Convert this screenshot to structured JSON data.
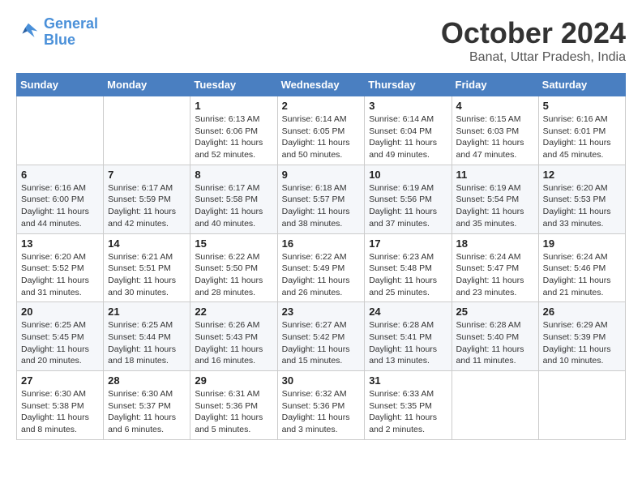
{
  "header": {
    "logo_line1": "General",
    "logo_line2": "Blue",
    "month_title": "October 2024",
    "subtitle": "Banat, Uttar Pradesh, India"
  },
  "weekdays": [
    "Sunday",
    "Monday",
    "Tuesday",
    "Wednesday",
    "Thursday",
    "Friday",
    "Saturday"
  ],
  "weeks": [
    [
      {
        "day": "",
        "sunrise": "",
        "sunset": "",
        "daylight": ""
      },
      {
        "day": "",
        "sunrise": "",
        "sunset": "",
        "daylight": ""
      },
      {
        "day": "1",
        "sunrise": "Sunrise: 6:13 AM",
        "sunset": "Sunset: 6:06 PM",
        "daylight": "Daylight: 11 hours and 52 minutes."
      },
      {
        "day": "2",
        "sunrise": "Sunrise: 6:14 AM",
        "sunset": "Sunset: 6:05 PM",
        "daylight": "Daylight: 11 hours and 50 minutes."
      },
      {
        "day": "3",
        "sunrise": "Sunrise: 6:14 AM",
        "sunset": "Sunset: 6:04 PM",
        "daylight": "Daylight: 11 hours and 49 minutes."
      },
      {
        "day": "4",
        "sunrise": "Sunrise: 6:15 AM",
        "sunset": "Sunset: 6:03 PM",
        "daylight": "Daylight: 11 hours and 47 minutes."
      },
      {
        "day": "5",
        "sunrise": "Sunrise: 6:16 AM",
        "sunset": "Sunset: 6:01 PM",
        "daylight": "Daylight: 11 hours and 45 minutes."
      }
    ],
    [
      {
        "day": "6",
        "sunrise": "Sunrise: 6:16 AM",
        "sunset": "Sunset: 6:00 PM",
        "daylight": "Daylight: 11 hours and 44 minutes."
      },
      {
        "day": "7",
        "sunrise": "Sunrise: 6:17 AM",
        "sunset": "Sunset: 5:59 PM",
        "daylight": "Daylight: 11 hours and 42 minutes."
      },
      {
        "day": "8",
        "sunrise": "Sunrise: 6:17 AM",
        "sunset": "Sunset: 5:58 PM",
        "daylight": "Daylight: 11 hours and 40 minutes."
      },
      {
        "day": "9",
        "sunrise": "Sunrise: 6:18 AM",
        "sunset": "Sunset: 5:57 PM",
        "daylight": "Daylight: 11 hours and 38 minutes."
      },
      {
        "day": "10",
        "sunrise": "Sunrise: 6:19 AM",
        "sunset": "Sunset: 5:56 PM",
        "daylight": "Daylight: 11 hours and 37 minutes."
      },
      {
        "day": "11",
        "sunrise": "Sunrise: 6:19 AM",
        "sunset": "Sunset: 5:54 PM",
        "daylight": "Daylight: 11 hours and 35 minutes."
      },
      {
        "day": "12",
        "sunrise": "Sunrise: 6:20 AM",
        "sunset": "Sunset: 5:53 PM",
        "daylight": "Daylight: 11 hours and 33 minutes."
      }
    ],
    [
      {
        "day": "13",
        "sunrise": "Sunrise: 6:20 AM",
        "sunset": "Sunset: 5:52 PM",
        "daylight": "Daylight: 11 hours and 31 minutes."
      },
      {
        "day": "14",
        "sunrise": "Sunrise: 6:21 AM",
        "sunset": "Sunset: 5:51 PM",
        "daylight": "Daylight: 11 hours and 30 minutes."
      },
      {
        "day": "15",
        "sunrise": "Sunrise: 6:22 AM",
        "sunset": "Sunset: 5:50 PM",
        "daylight": "Daylight: 11 hours and 28 minutes."
      },
      {
        "day": "16",
        "sunrise": "Sunrise: 6:22 AM",
        "sunset": "Sunset: 5:49 PM",
        "daylight": "Daylight: 11 hours and 26 minutes."
      },
      {
        "day": "17",
        "sunrise": "Sunrise: 6:23 AM",
        "sunset": "Sunset: 5:48 PM",
        "daylight": "Daylight: 11 hours and 25 minutes."
      },
      {
        "day": "18",
        "sunrise": "Sunrise: 6:24 AM",
        "sunset": "Sunset: 5:47 PM",
        "daylight": "Daylight: 11 hours and 23 minutes."
      },
      {
        "day": "19",
        "sunrise": "Sunrise: 6:24 AM",
        "sunset": "Sunset: 5:46 PM",
        "daylight": "Daylight: 11 hours and 21 minutes."
      }
    ],
    [
      {
        "day": "20",
        "sunrise": "Sunrise: 6:25 AM",
        "sunset": "Sunset: 5:45 PM",
        "daylight": "Daylight: 11 hours and 20 minutes."
      },
      {
        "day": "21",
        "sunrise": "Sunrise: 6:25 AM",
        "sunset": "Sunset: 5:44 PM",
        "daylight": "Daylight: 11 hours and 18 minutes."
      },
      {
        "day": "22",
        "sunrise": "Sunrise: 6:26 AM",
        "sunset": "Sunset: 5:43 PM",
        "daylight": "Daylight: 11 hours and 16 minutes."
      },
      {
        "day": "23",
        "sunrise": "Sunrise: 6:27 AM",
        "sunset": "Sunset: 5:42 PM",
        "daylight": "Daylight: 11 hours and 15 minutes."
      },
      {
        "day": "24",
        "sunrise": "Sunrise: 6:28 AM",
        "sunset": "Sunset: 5:41 PM",
        "daylight": "Daylight: 11 hours and 13 minutes."
      },
      {
        "day": "25",
        "sunrise": "Sunrise: 6:28 AM",
        "sunset": "Sunset: 5:40 PM",
        "daylight": "Daylight: 11 hours and 11 minutes."
      },
      {
        "day": "26",
        "sunrise": "Sunrise: 6:29 AM",
        "sunset": "Sunset: 5:39 PM",
        "daylight": "Daylight: 11 hours and 10 minutes."
      }
    ],
    [
      {
        "day": "27",
        "sunrise": "Sunrise: 6:30 AM",
        "sunset": "Sunset: 5:38 PM",
        "daylight": "Daylight: 11 hours and 8 minutes."
      },
      {
        "day": "28",
        "sunrise": "Sunrise: 6:30 AM",
        "sunset": "Sunset: 5:37 PM",
        "daylight": "Daylight: 11 hours and 6 minutes."
      },
      {
        "day": "29",
        "sunrise": "Sunrise: 6:31 AM",
        "sunset": "Sunset: 5:36 PM",
        "daylight": "Daylight: 11 hours and 5 minutes."
      },
      {
        "day": "30",
        "sunrise": "Sunrise: 6:32 AM",
        "sunset": "Sunset: 5:36 PM",
        "daylight": "Daylight: 11 hours and 3 minutes."
      },
      {
        "day": "31",
        "sunrise": "Sunrise: 6:33 AM",
        "sunset": "Sunset: 5:35 PM",
        "daylight": "Daylight: 11 hours and 2 minutes."
      },
      {
        "day": "",
        "sunrise": "",
        "sunset": "",
        "daylight": ""
      },
      {
        "day": "",
        "sunrise": "",
        "sunset": "",
        "daylight": ""
      }
    ]
  ]
}
